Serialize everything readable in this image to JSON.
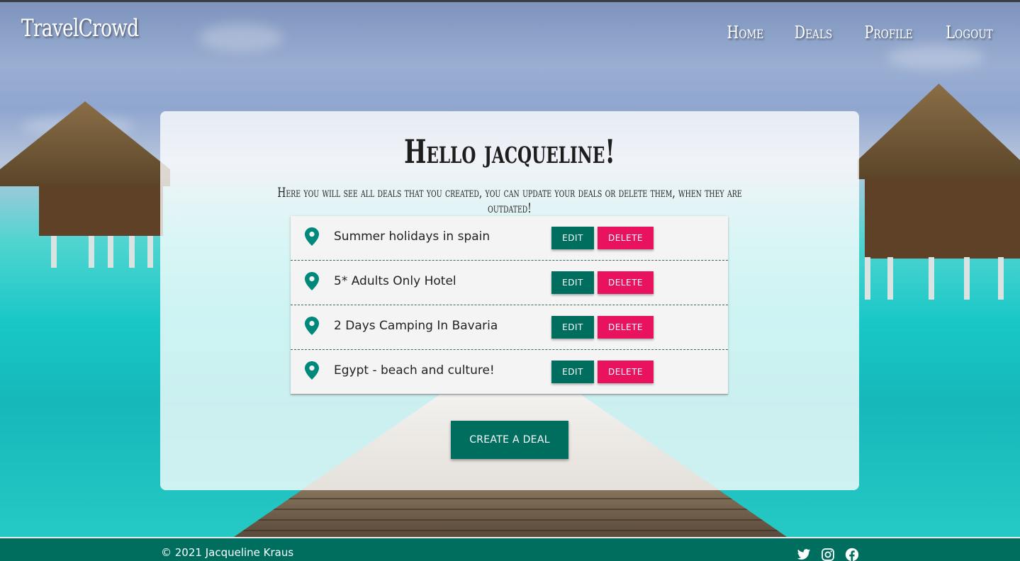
{
  "header": {
    "brand": "TravelCrowd",
    "nav": [
      "Home",
      "Deals",
      "Profile",
      "Logout"
    ]
  },
  "main": {
    "greeting": "Hello jacqueline!",
    "subtitle": "Here you will see all deals that you created, you can update your deals or delete them, when they are outdated!",
    "deals": [
      {
        "title": "Summer holidays in spain",
        "edit": "EDIT",
        "delete": "DELETE"
      },
      {
        "title": "5* Adults Only Hotel",
        "edit": "EDIT",
        "delete": "DELETE"
      },
      {
        "title": "2 Days Camping In Bavaria",
        "edit": "EDIT",
        "delete": "DELETE"
      },
      {
        "title": "Egypt - beach and culture!",
        "edit": "EDIT",
        "delete": "DELETE"
      }
    ],
    "create_button": "CREATE A DEAL"
  },
  "footer": {
    "copyright": "© 2021 Jacqueline Kraus",
    "social_icons": [
      "twitter-icon",
      "instagram-icon",
      "facebook-icon"
    ]
  },
  "colors": {
    "primary": "#006e5f",
    "danger": "#e8125e",
    "pin": "#00897b"
  }
}
